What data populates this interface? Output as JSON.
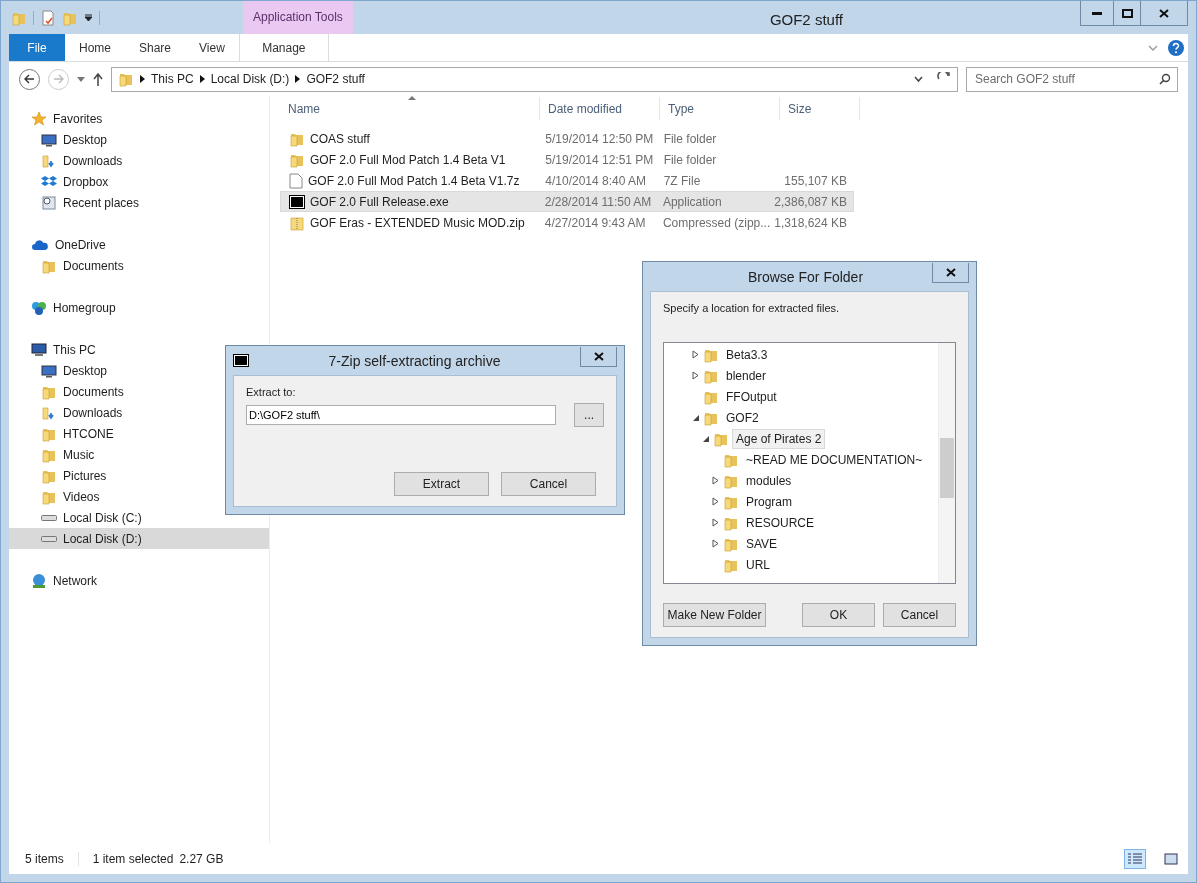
{
  "window": {
    "title": "GOF2 stuff",
    "context_group": "Application Tools"
  },
  "ribbon_tabs": [
    {
      "label": "File",
      "kind": "file"
    },
    {
      "label": "Home",
      "kind": "tab"
    },
    {
      "label": "Share",
      "kind": "tab"
    },
    {
      "label": "View",
      "kind": "tab"
    },
    {
      "label": "Manage",
      "kind": "context"
    }
  ],
  "address": {
    "crumbs": [
      "This PC",
      "Local Disk (D:)",
      "GOF2 stuff"
    ],
    "search_placeholder": "Search GOF2 stuff"
  },
  "nav": [
    {
      "label": "Favorites",
      "kind": "star",
      "selected": false,
      "children": [
        {
          "label": "Desktop",
          "kind": "desktop",
          "selected": false
        },
        {
          "label": "Downloads",
          "kind": "downloads",
          "selected": false
        },
        {
          "label": "Dropbox",
          "kind": "dropbox",
          "selected": false
        },
        {
          "label": "Recent places",
          "kind": "recent",
          "selected": false
        }
      ]
    },
    {
      "label": "OneDrive",
      "kind": "cloud",
      "selected": false,
      "children": [
        {
          "label": "Documents",
          "kind": "folder",
          "selected": false
        }
      ]
    },
    {
      "label": "Homegroup",
      "kind": "homegroup",
      "selected": false
    },
    {
      "label": "This PC",
      "kind": "pc",
      "selected": false,
      "children": [
        {
          "label": "Desktop",
          "kind": "desktop",
          "selected": false
        },
        {
          "label": "Documents",
          "kind": "folder",
          "selected": false
        },
        {
          "label": "Downloads",
          "kind": "downloads",
          "selected": false
        },
        {
          "label": "HTCONE",
          "kind": "folder",
          "selected": false
        },
        {
          "label": "Music",
          "kind": "folder",
          "selected": false
        },
        {
          "label": "Pictures",
          "kind": "folder",
          "selected": false
        },
        {
          "label": "Videos",
          "kind": "folder",
          "selected": false
        },
        {
          "label": "Local Disk (C:)",
          "kind": "drive",
          "selected": false
        },
        {
          "label": "Local Disk (D:)",
          "kind": "drive",
          "selected": true
        }
      ]
    },
    {
      "label": "Network",
      "kind": "network",
      "selected": false
    }
  ],
  "columns": [
    "Name",
    "Date modified",
    "Type",
    "Size"
  ],
  "files": [
    {
      "name": "COAS stuff",
      "date": "5/19/2014 12:50 PM",
      "type": "File folder",
      "kind": "folder",
      "selected": false
    },
    {
      "name": "GOF 2.0 Full Mod Patch 1.4 Beta V1",
      "date": "5/19/2014 12:51 PM",
      "type": "File folder",
      "kind": "folder",
      "selected": false
    },
    {
      "name": "GOF 2.0 Full Mod Patch 1.4 Beta V1.7z",
      "date": "4/10/2014 8:40 AM",
      "type": "7Z File",
      "size": "155,107 KB",
      "kind": "file",
      "selected": false
    },
    {
      "name": "GOF 2.0 Full Release.exe",
      "date": "2/28/2014 11:50 AM",
      "type": "Application",
      "size": "2,386,087 KB",
      "kind": "sevenzip",
      "selected": true
    },
    {
      "name": "GOF Eras - EXTENDED Music MOD.zip",
      "date": "4/27/2014 9:43 AM",
      "type": "Compressed (zipp...",
      "size": "1,318,624 KB",
      "kind": "zip",
      "selected": false
    }
  ],
  "status_bar": {
    "count": "5 items",
    "selection": "1 item selected",
    "selection_size": "2.27 GB"
  },
  "sfx_dialog": {
    "title": "7-Zip self-extracting archive",
    "label": "Extract to:",
    "value": "D:\\GOF2 stuff\\",
    "browse": "...",
    "buttons": [
      "Extract",
      "Cancel"
    ]
  },
  "browse_dialog": {
    "title": "Browse For Folder",
    "prompt": "Specify a location for extracted files.",
    "tree": [
      {
        "label": "Beta3.3",
        "expanded": false,
        "selected": false
      },
      {
        "label": "blender",
        "expanded": false,
        "selected": false
      },
      {
        "label": "FFOutput",
        "selected": false
      },
      {
        "label": "GOF2",
        "expanded": true,
        "selected": false,
        "children": [
          {
            "label": "Age of Pirates 2",
            "expanded": true,
            "selected": true,
            "children": [
              {
                "label": "~READ ME DOCUMENTATION~",
                "selected": false
              },
              {
                "label": "modules",
                "expanded": false,
                "selected": false
              },
              {
                "label": "Program",
                "expanded": false,
                "selected": false
              },
              {
                "label": "RESOURCE",
                "expanded": false,
                "selected": false
              },
              {
                "label": "SAVE",
                "expanded": false,
                "selected": false
              },
              {
                "label": "URL",
                "selected": false
              }
            ]
          }
        ]
      }
    ],
    "buttons": [
      "Make New Folder",
      "OK",
      "Cancel"
    ]
  }
}
